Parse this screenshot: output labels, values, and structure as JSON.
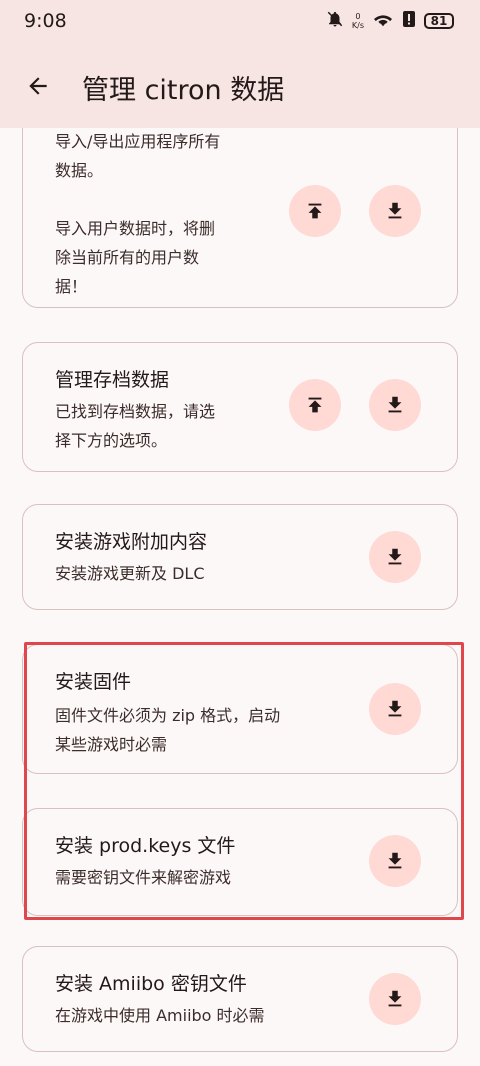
{
  "status": {
    "time": "9:08",
    "net_value": "0",
    "net_unit": "K/s",
    "battery": "81"
  },
  "appbar": {
    "title": "管理 citron 数据"
  },
  "cards": [
    {
      "title": "",
      "desc": "导入/导出应用程序所有\n数据。\n\n导入用户数据时，将删\n除当前所有的用户数\n据！"
    },
    {
      "title": "管理存档数据",
      "desc": "已找到存档数据，请选\n择下方的选项。"
    },
    {
      "title": "安装游戏附加内容",
      "desc": "安装游戏更新及 DLC"
    },
    {
      "title": "安装固件",
      "desc": "固件文件必须为 zip 格式，启动\n某些游戏时必需"
    },
    {
      "title": "安装 prod.keys 文件",
      "desc": "需要密钥文件来解密游戏"
    },
    {
      "title": "安装 Amiibo 密钥文件",
      "desc": "在游戏中使用 Amiibo 时必需"
    }
  ],
  "colors": {
    "accent_bg": "#ffdad5",
    "appbar_bg": "#f6e5e3",
    "highlight": "#e0474c"
  }
}
